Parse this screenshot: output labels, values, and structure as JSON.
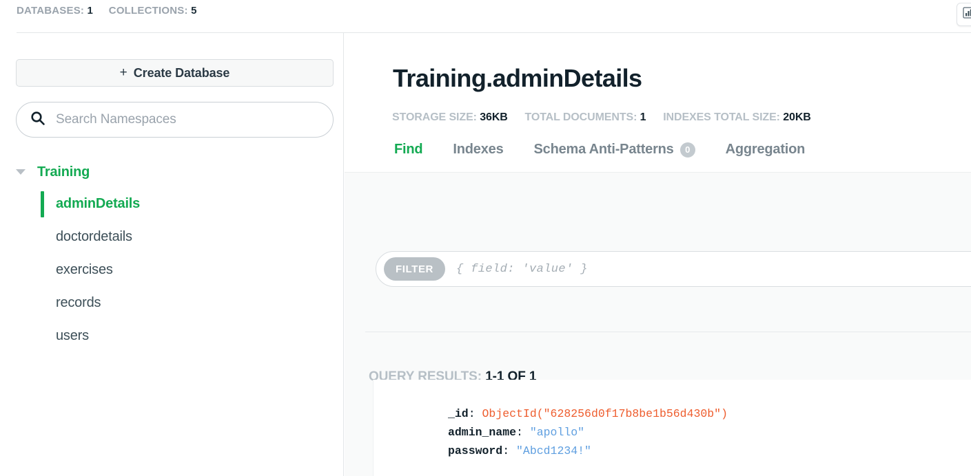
{
  "top_bar": {
    "databases_label": "DATABASES:",
    "databases_count": "1",
    "collections_label": "COLLECTIONS:",
    "collections_count": "5",
    "analytics_icon": "bar-chart-icon"
  },
  "sidebar": {
    "create_database_button": {
      "plus": "+",
      "label": "Create Database"
    },
    "search": {
      "icon": "search-icon",
      "placeholder": "Search Namespaces"
    },
    "tree": {
      "database": {
        "name": "Training",
        "expanded": true,
        "caret_icon": "caret-down-icon"
      },
      "collections": [
        {
          "name": "adminDetails",
          "active": true
        },
        {
          "name": "doctordetails",
          "active": false
        },
        {
          "name": "exercises",
          "active": false
        },
        {
          "name": "records",
          "active": false
        },
        {
          "name": "users",
          "active": false
        }
      ]
    }
  },
  "main": {
    "title": "Training.adminDetails",
    "stats": {
      "storage_size_label": "STORAGE SIZE:",
      "storage_size_value": "36KB",
      "total_documents_label": "TOTAL DOCUMENTS:",
      "total_documents_value": "1",
      "indexes_total_size_label": "INDEXES TOTAL SIZE:",
      "indexes_total_size_value": "20KB"
    },
    "tabs": [
      {
        "label": "Find",
        "active": true,
        "badge": null
      },
      {
        "label": "Indexes",
        "active": false,
        "badge": null
      },
      {
        "label": "Schema Anti-Patterns",
        "active": false,
        "badge": "0"
      },
      {
        "label": "Aggregation",
        "active": false,
        "badge": null
      }
    ],
    "filter": {
      "pill_label": "FILTER",
      "placeholder": "{ field: 'value' }",
      "value": ""
    },
    "query_results": {
      "label": "QUERY RESULTS:",
      "value": "1-1 OF 1"
    },
    "document": {
      "fields": [
        {
          "key": "_id",
          "value": "ObjectId(\"628256d0f17b8be1b56d430b\")",
          "type": "objectid"
        },
        {
          "key": "admin_name",
          "value": "\"apollo\"",
          "type": "string"
        },
        {
          "key": "password",
          "value": "\"Abcd1234!\"",
          "type": "string"
        }
      ]
    }
  },
  "colors": {
    "brand_green": "#13aa52",
    "text_dark": "#12212b",
    "text_muted": "#b6bfc6",
    "objectid_orange": "#ee5d2e",
    "string_blue": "#5f9fe0",
    "panel_bg": "#f9fafa"
  }
}
